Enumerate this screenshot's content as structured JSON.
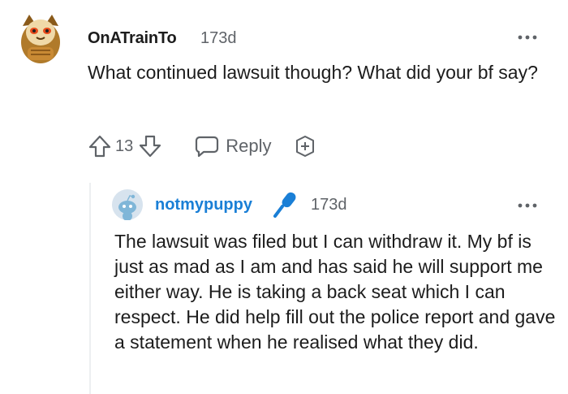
{
  "comment": {
    "username": "OnATrainTo",
    "age": "173d",
    "body": "What continued lawsuit though? What did your bf say?",
    "score": "13",
    "reply_label": "Reply"
  },
  "reply": {
    "username": "notmypuppy",
    "age": "173d",
    "body": "The lawsuit was filed but I can withdraw it. My bf is just as mad as I am and has said he will support me either way. He is taking a back seat which I can respect. He did help fill out the police report and gave a statement when he realised what they did."
  },
  "icons": {
    "avatar1": "orange-cat-avatar",
    "avatar2": "snoo-avatar",
    "more": "more-options-icon",
    "upvote": "upvote-arrow-icon",
    "downvote": "downvote-arrow-icon",
    "reply": "speech-bubble-icon",
    "award": "award-icon",
    "mic": "microphone-icon"
  },
  "colors": {
    "username_reply": "#1a7fd6",
    "mic": "#1a7fd6",
    "text": "#1c1c1c",
    "meta": "#5f6368"
  }
}
